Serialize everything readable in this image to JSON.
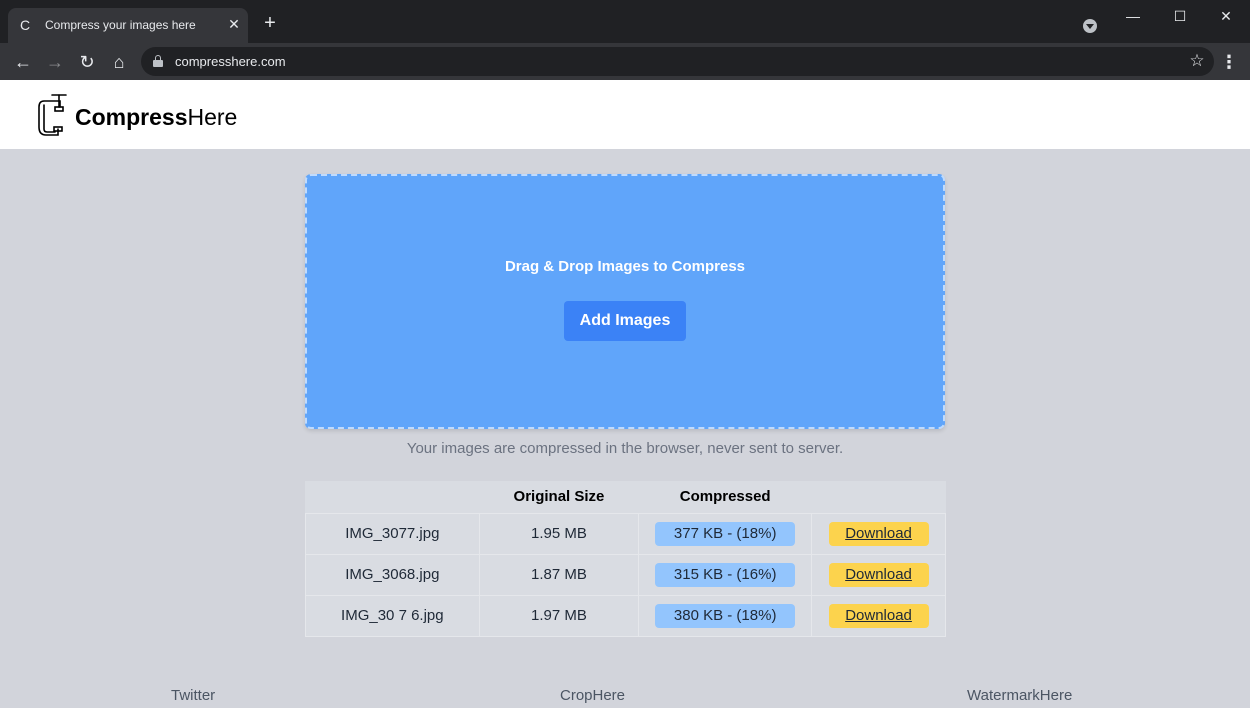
{
  "browser": {
    "tab_title": "Compress your images here",
    "tab_favicon": "C",
    "close_glyph": "✕",
    "new_tab_glyph": "+",
    "url": "compresshere.com",
    "win_min": "—",
    "win_max": "☐",
    "win_close": "✕",
    "back_glyph": "←",
    "forward_glyph": "→",
    "reload_glyph": "↻",
    "home_glyph": "⌂",
    "star_glyph": "☆",
    "menu_glyph": "⋮"
  },
  "site": {
    "logo_bold": "Compress",
    "logo_regular": "Here"
  },
  "dropzone": {
    "title": "Drag & Drop Images to Compress",
    "button": "Add Images"
  },
  "note": "Your images are compressed in the browser, never sent to server.",
  "table": {
    "headers": [
      "",
      "Original Size",
      "Compressed",
      ""
    ],
    "rows": [
      {
        "name": "IMG_3077.jpg",
        "original": "1.95 MB",
        "compressed": "377 KB - (18%)",
        "action": "Download"
      },
      {
        "name": "IMG_3068.jpg",
        "original": "1.87 MB",
        "compressed": "315 KB - (16%)",
        "action": "Download"
      },
      {
        "name": "IMG_30 7 6.jpg",
        "original": "1.97 MB",
        "compressed": "380 KB - (18%)",
        "action": "Download"
      }
    ]
  },
  "footer": {
    "links": [
      "Twitter",
      "CropHere",
      "WatermarkHere"
    ]
  },
  "colors": {
    "dropzone": "#60a5fa",
    "add_button": "#3b82f6",
    "compressed_pill": "#93c5fd",
    "download_button": "#fcd34d",
    "page_bg": "#d2d4db"
  }
}
